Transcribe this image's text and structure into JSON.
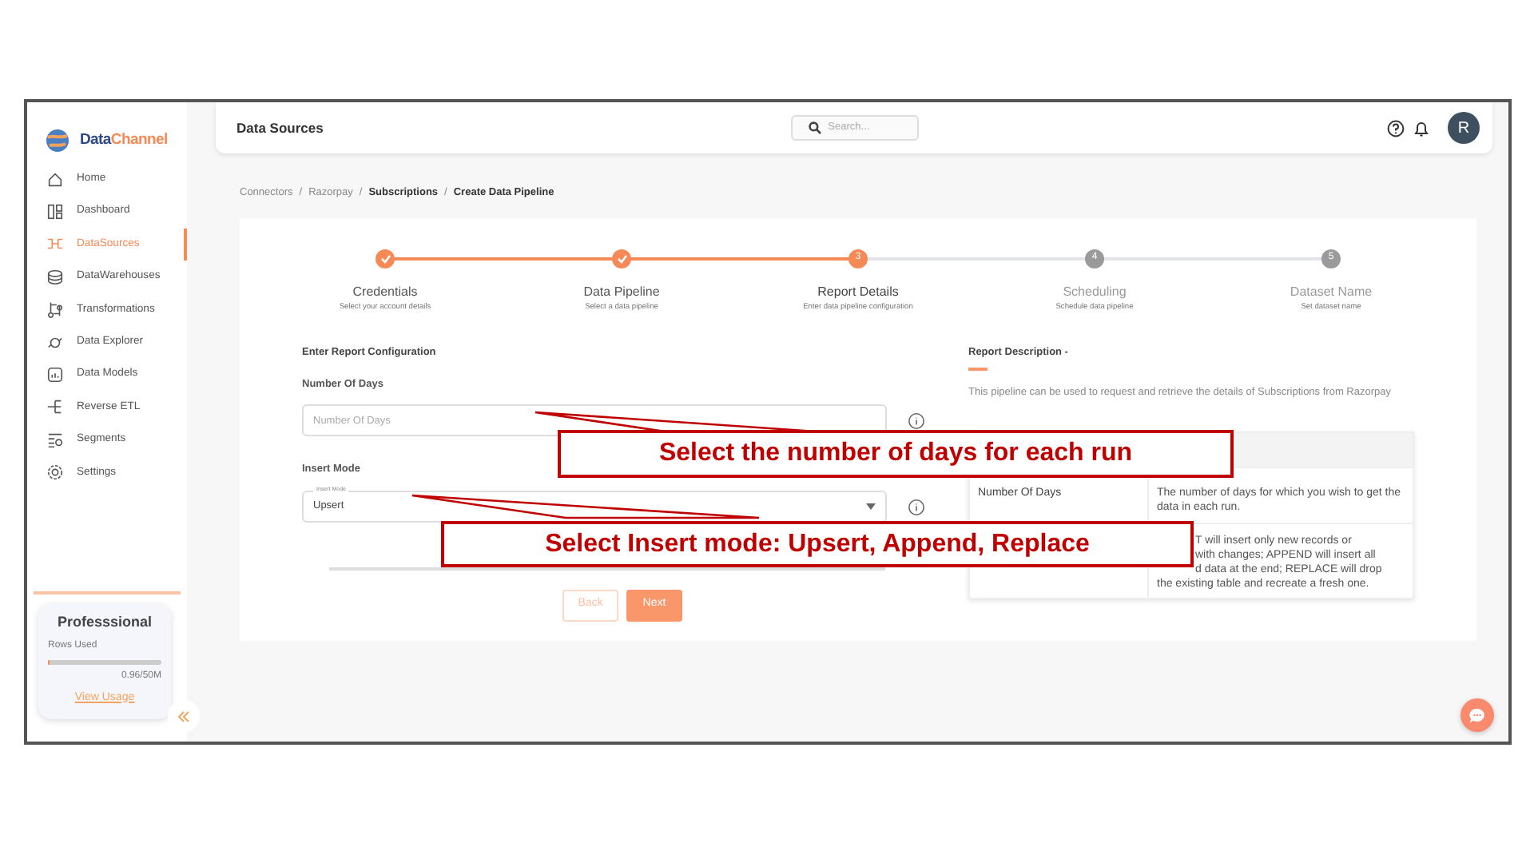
{
  "sidebar": {
    "logo": {
      "first": "Data",
      "second": "Channel"
    },
    "items": [
      {
        "label": "Home",
        "selected": false
      },
      {
        "label": "Dashboard",
        "selected": false
      },
      {
        "label": "DataSources",
        "selected": true
      },
      {
        "label": "DataWarehouses",
        "selected": false
      },
      {
        "label": "Transformations",
        "selected": false
      },
      {
        "label": "Data Explorer",
        "selected": false
      },
      {
        "label": "Data Models",
        "selected": false
      },
      {
        "label": "Reverse ETL",
        "selected": false
      },
      {
        "label": "Segments",
        "selected": false
      },
      {
        "label": "Settings",
        "selected": false
      }
    ],
    "plan": {
      "name": "Professsional",
      "label": "Rows Used",
      "level": 0.02,
      "reading": "0.96/50M",
      "link": "View Usage"
    }
  },
  "header": {
    "title": "Data Sources",
    "search": {
      "placeholder": "Search..."
    },
    "avatar": "R"
  },
  "breadcrumb": [
    {
      "label": "Connectors",
      "bold": false
    },
    {
      "separator": "/",
      "label": "Razorpay",
      "bold": false
    },
    {
      "separator": "/",
      "label": "Subscriptions",
      "bold": true
    },
    {
      "separator": "/",
      "label": "Create Data Pipeline",
      "bold": true
    }
  ],
  "steps": [
    {
      "label": "Credentials",
      "subtitle": "Select your account details",
      "completed": true,
      "active": false
    },
    {
      "label": "Data Pipeline",
      "subtitle": "Select a data pipeline",
      "completed": true,
      "active": false
    },
    {
      "label": "Report Details",
      "subtitle": "Enter data pipeline configuration",
      "completed": false,
      "active": true,
      "number": "3"
    },
    {
      "label": "Scheduling",
      "subtitle": "Schedule data pipeline",
      "completed": false,
      "active": false,
      "number": "4"
    },
    {
      "label": "Dataset Name",
      "subtitle": "Set dataset name",
      "completed": false,
      "active": false,
      "number": "5"
    }
  ],
  "form": {
    "title": "Enter Report Configuration",
    "fields": [
      {
        "kind": "input",
        "label": "Number Of Days",
        "placeholder": "Number Of Days"
      },
      {
        "kind": "select",
        "label": "Insert Mode",
        "floating_label": "Insert Mode",
        "value": "Upsert"
      }
    ],
    "buttons": [
      {
        "label": "Back",
        "disabled": true
      },
      {
        "label": "Next",
        "disabled": false
      }
    ]
  },
  "description": {
    "title": "Report Description -",
    "text": "This pipeline can be used to request and retrieve the details of Subscriptions from Razorpay",
    "rows": [
      {
        "name": "Number Of Days",
        "lines": [
          "The number of days for which you wish to get the data in each run."
        ]
      },
      {
        "lines": [
          "T will insert only new records or",
          "with changes; APPEND will insert all",
          "d data at the end; REPLACE will drop",
          "the existing table and recreate a fresh one."
        ]
      }
    ]
  },
  "callouts": [
    "Select the number of days for each run",
    "Select Insert mode: Upsert, Append, Replace"
  ]
}
